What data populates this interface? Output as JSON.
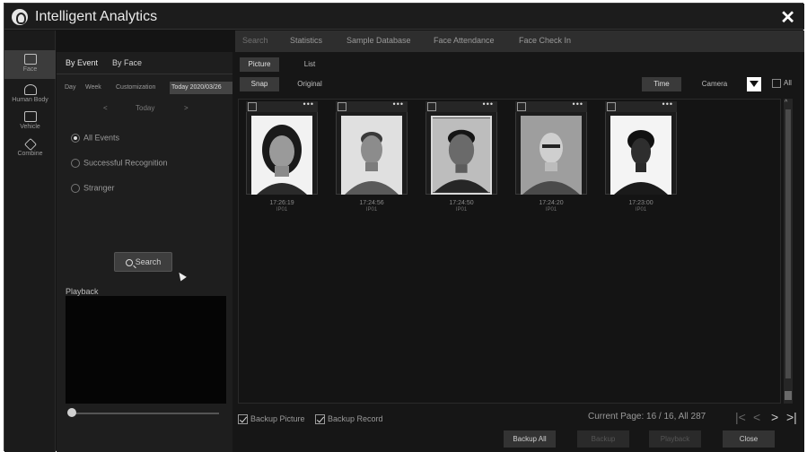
{
  "app": {
    "title": "Intelligent Analytics",
    "close_icon": "close-icon"
  },
  "topnav": [
    {
      "label": "Search",
      "active": true
    },
    {
      "label": "Statistics"
    },
    {
      "label": "Sample Database"
    },
    {
      "label": "Face Attendance"
    },
    {
      "label": "Face Check In"
    }
  ],
  "rail": [
    {
      "label": "Face",
      "icon": "face-icon",
      "active": true
    },
    {
      "label": "Human Body",
      "icon": "human-body-icon"
    },
    {
      "label": "Vehicle",
      "icon": "vehicle-icon"
    },
    {
      "label": "Combine",
      "icon": "combine-icon"
    }
  ],
  "panel": {
    "tabs": [
      "By Event",
      "By Face"
    ],
    "ranges": [
      "Day",
      "Week",
      "Customization"
    ],
    "today_value": "Today 2020/03/26",
    "prev": "<",
    "day_label": "Today",
    "next": ">",
    "radios": [
      "All Events",
      "Successful Recognition",
      "Stranger"
    ],
    "search_label": "Search",
    "playback_label": "Playback"
  },
  "view_tabs": [
    "Picture",
    "List"
  ],
  "image_tabs": [
    "Snap",
    "Original"
  ],
  "sort_tabs": [
    "Time",
    "Camera"
  ],
  "all_label": "All",
  "cards": [
    {
      "time": "17:26:19",
      "camera": "IP01",
      "dots": "•••"
    },
    {
      "time": "17:24:56",
      "camera": "IP01",
      "dots": "•••"
    },
    {
      "time": "17:24:50",
      "camera": "IP01",
      "dots": "•••"
    },
    {
      "time": "17:24:20",
      "camera": "IP01",
      "dots": "•••"
    },
    {
      "time": "17:23:00",
      "camera": "IP01",
      "dots": "•••"
    }
  ],
  "bottom": {
    "backup_picture": "Backup Picture",
    "backup_record": "Backup Record",
    "page_info": "Current Page: 16 / 16, All 287",
    "buttons": [
      "Backup All",
      "Backup",
      "Playback",
      "Close"
    ]
  }
}
